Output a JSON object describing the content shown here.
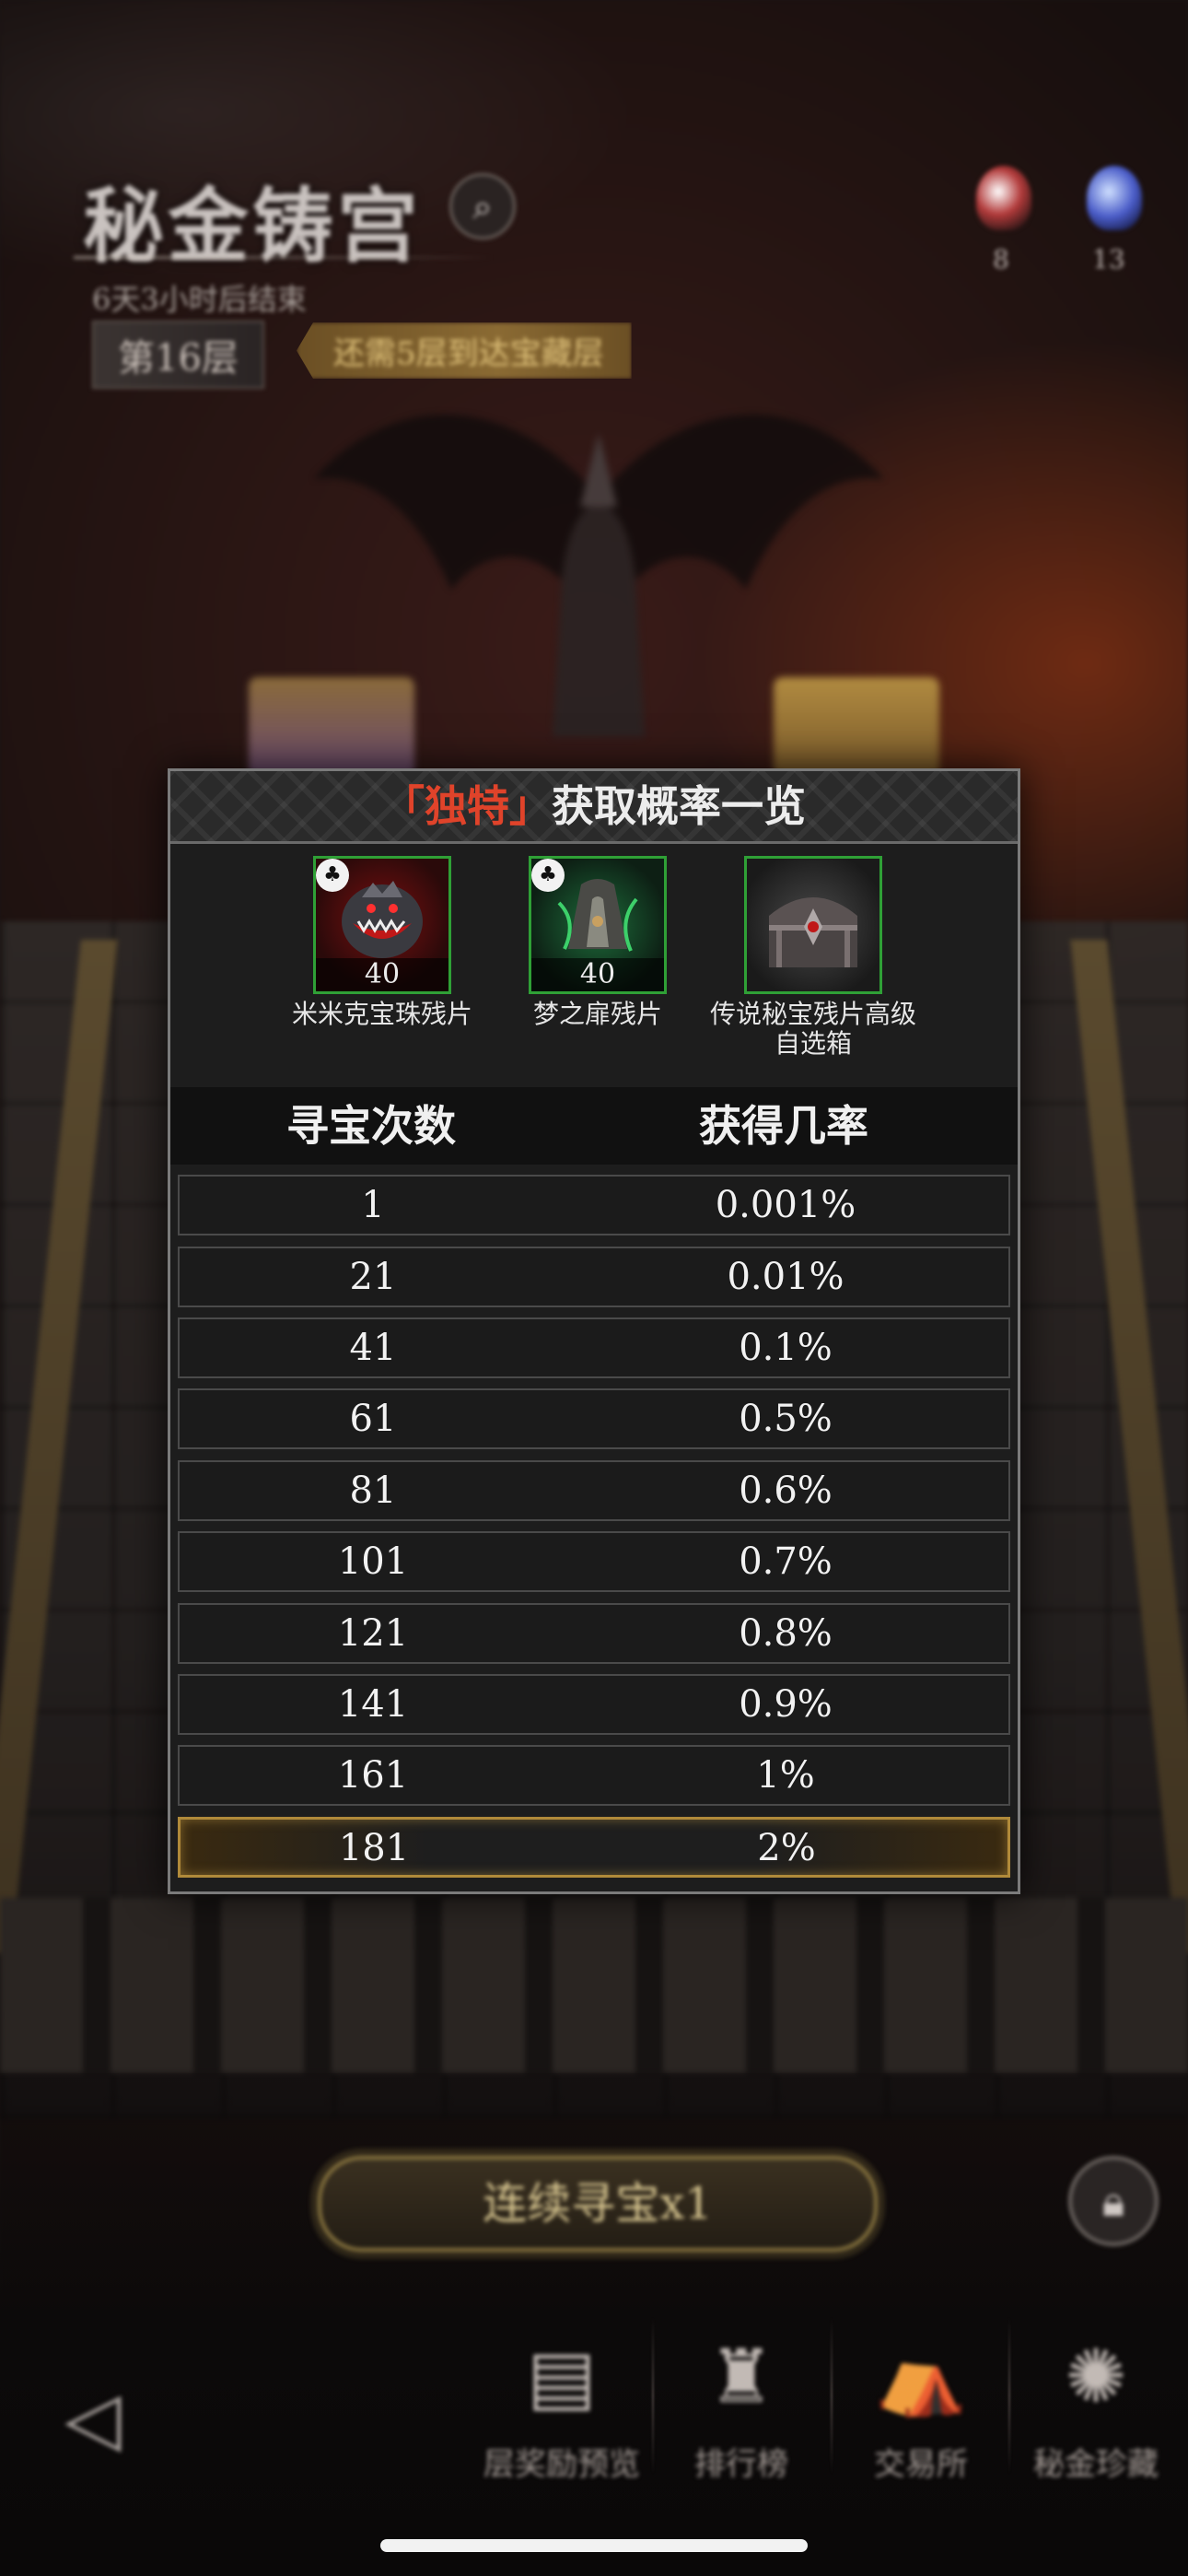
{
  "hud": {
    "title": "秘金铸宫",
    "subtitle": "6天3小时后结束",
    "floor": "第16层",
    "floor_tip": "还需5层到达宝藏层",
    "currency_a_count": "8",
    "currency_b_count": "13"
  },
  "modal": {
    "title_prefix": "「",
    "title_highlight": "独特",
    "title_suffix": "」",
    "title_rest": "获取概率一览",
    "rewards": [
      {
        "name": "米米克宝珠残片",
        "quantity": "40",
        "icon": "mimic-orb-fragment-icon"
      },
      {
        "name": "梦之扉残片",
        "quantity": "40",
        "icon": "dream-door-fragment-icon"
      },
      {
        "name": "传说秘宝残片高级自选箱",
        "quantity": "",
        "icon": "treasure-chest-icon"
      }
    ],
    "table": {
      "headers": [
        "寻宝次数",
        "获得几率"
      ],
      "rows": [
        {
          "count": "1",
          "rate": "0.001%"
        },
        {
          "count": "21",
          "rate": "0.01%"
        },
        {
          "count": "41",
          "rate": "0.1%"
        },
        {
          "count": "61",
          "rate": "0.5%"
        },
        {
          "count": "81",
          "rate": "0.6%"
        },
        {
          "count": "101",
          "rate": "0.7%"
        },
        {
          "count": "121",
          "rate": "0.8%"
        },
        {
          "count": "141",
          "rate": "0.9%"
        },
        {
          "count": "161",
          "rate": "1%"
        },
        {
          "count": "181",
          "rate": "2%"
        }
      ],
      "highlighted_row": 9
    }
  },
  "actions": {
    "hunt_button": "连续寻宝x1"
  },
  "nav": [
    {
      "label": "层奖励预览",
      "icon": "reward-preview-icon"
    },
    {
      "label": "排行榜",
      "icon": "trophy-icon"
    },
    {
      "label": "交易所",
      "icon": "exchange-icon"
    },
    {
      "label": "秘金珍藏",
      "icon": "collection-icon"
    }
  ],
  "colors": {
    "accent_red": "#e0432a",
    "item_frame_green": "#2fa036",
    "highlight_gold": "#b08a3a"
  }
}
